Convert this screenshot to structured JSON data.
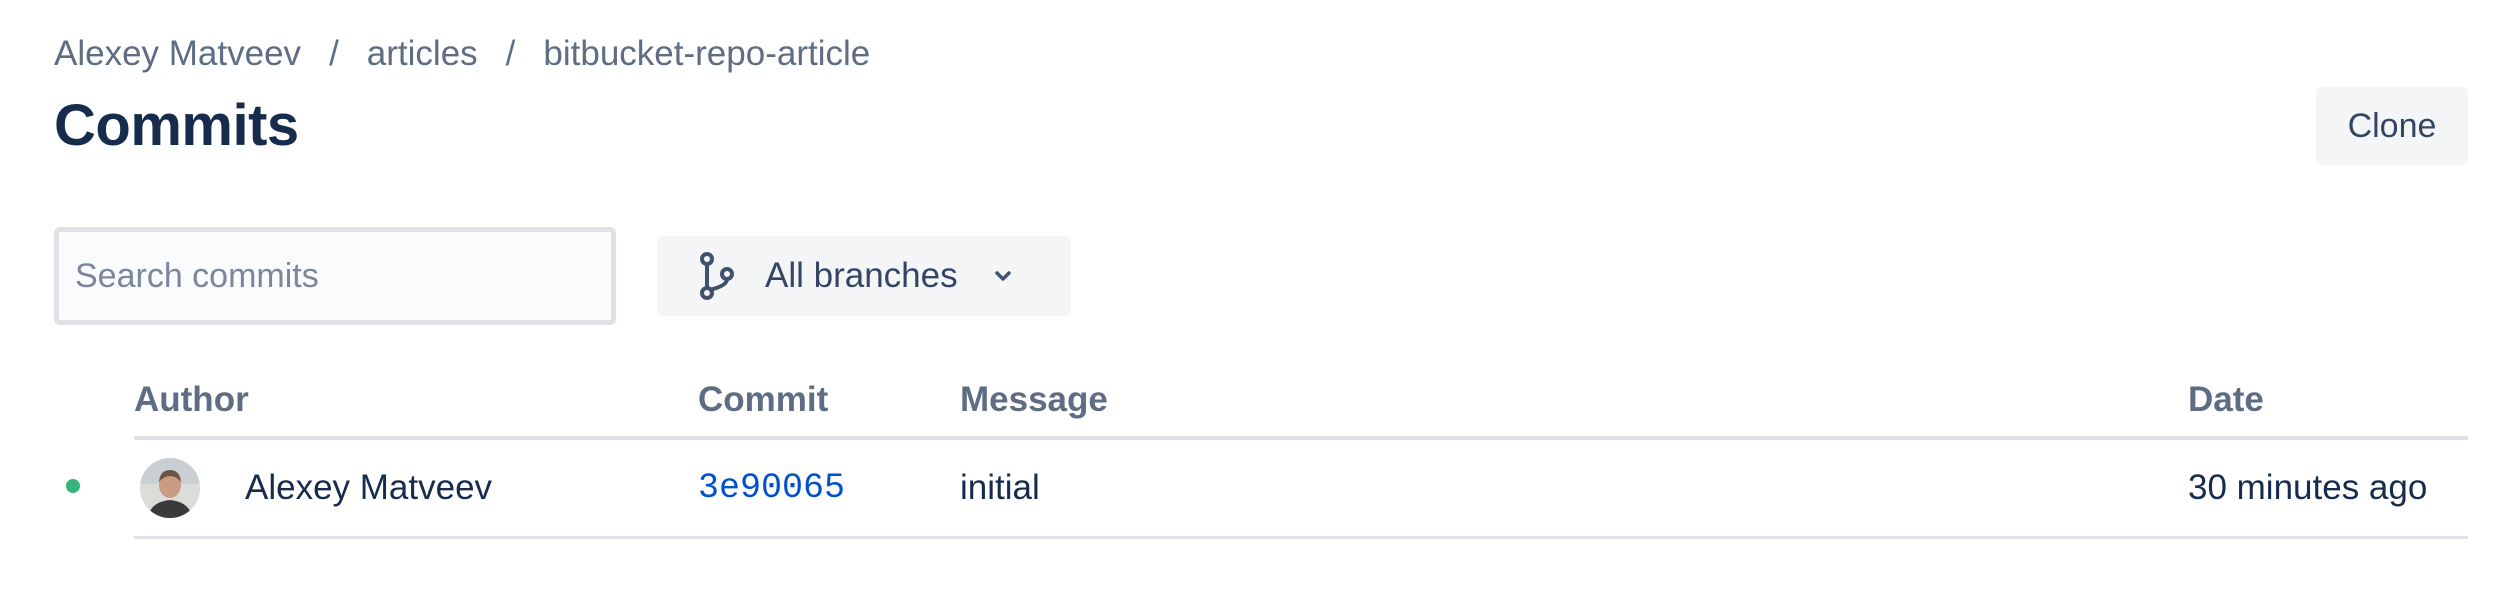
{
  "breadcrumb": {
    "items": [
      "Alexey Matveev",
      "articles",
      "bitbucket-repo-article"
    ],
    "separator": "/"
  },
  "page": {
    "title": "Commits",
    "clone_label": "Clone"
  },
  "filters": {
    "search_placeholder": "Search commits",
    "search_value": "",
    "branch_label": "All branches",
    "branch_icon": "branch-icon"
  },
  "table": {
    "headers": {
      "author": "Author",
      "commit": "Commit",
      "message": "Message",
      "date": "Date"
    },
    "rows": [
      {
        "status_color": "#36b37e",
        "author": "Alexey Matveev",
        "commit": "3e90065",
        "message": "initial",
        "date": "30 minutes ago"
      }
    ]
  },
  "colors": {
    "link": "#0052cc",
    "text": "#172b4d",
    "muted": "#5e6c84",
    "status_green": "#36b37e"
  }
}
